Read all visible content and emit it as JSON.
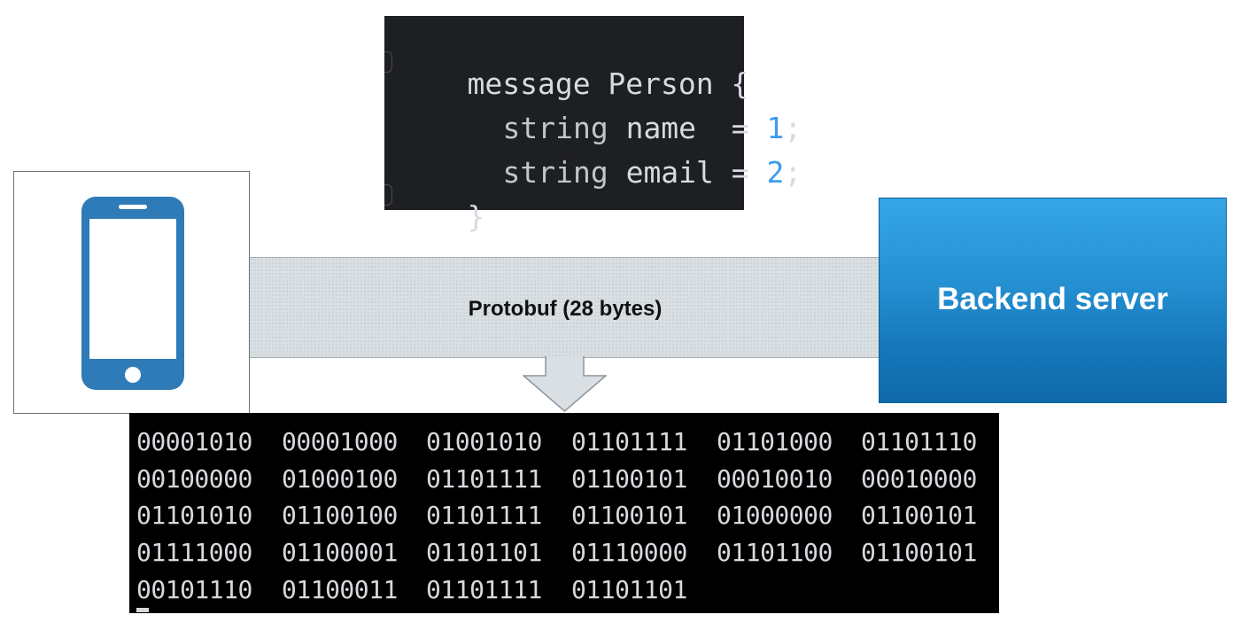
{
  "code": {
    "lines": [
      {
        "text": "message Person {"
      },
      {
        "keyword": "string",
        "field": " name  = ",
        "number": "1",
        "end": ";"
      },
      {
        "keyword": "string",
        "field": " email = ",
        "number": "2",
        "end": ";"
      },
      {
        "text": "}"
      }
    ]
  },
  "band": {
    "label": "Protobuf (28 bytes)"
  },
  "server": {
    "label": "Backend server"
  },
  "binary": {
    "rows": [
      [
        "00001010",
        "00001000",
        "01001010",
        "01101111",
        "01101000",
        "01101110"
      ],
      [
        "00100000",
        "01000100",
        "01101111",
        "01100101",
        "00010010",
        "00010000"
      ],
      [
        "01101010",
        "01100100",
        "01101111",
        "01100101",
        "01000000",
        "01100101"
      ],
      [
        "01111000",
        "01100001",
        "01101101",
        "01110000",
        "01101100",
        "01100101"
      ],
      [
        "00101110",
        "01100011",
        "01101111",
        "01101101"
      ]
    ]
  },
  "colors": {
    "server_top": "#35a6e6",
    "server_bottom": "#0f69a9",
    "phone_icon": "#2e7bb8",
    "code_number": "#3d9bf0"
  },
  "icons": {
    "client": "smartphone-icon",
    "arrow": "down-arrow-icon"
  }
}
